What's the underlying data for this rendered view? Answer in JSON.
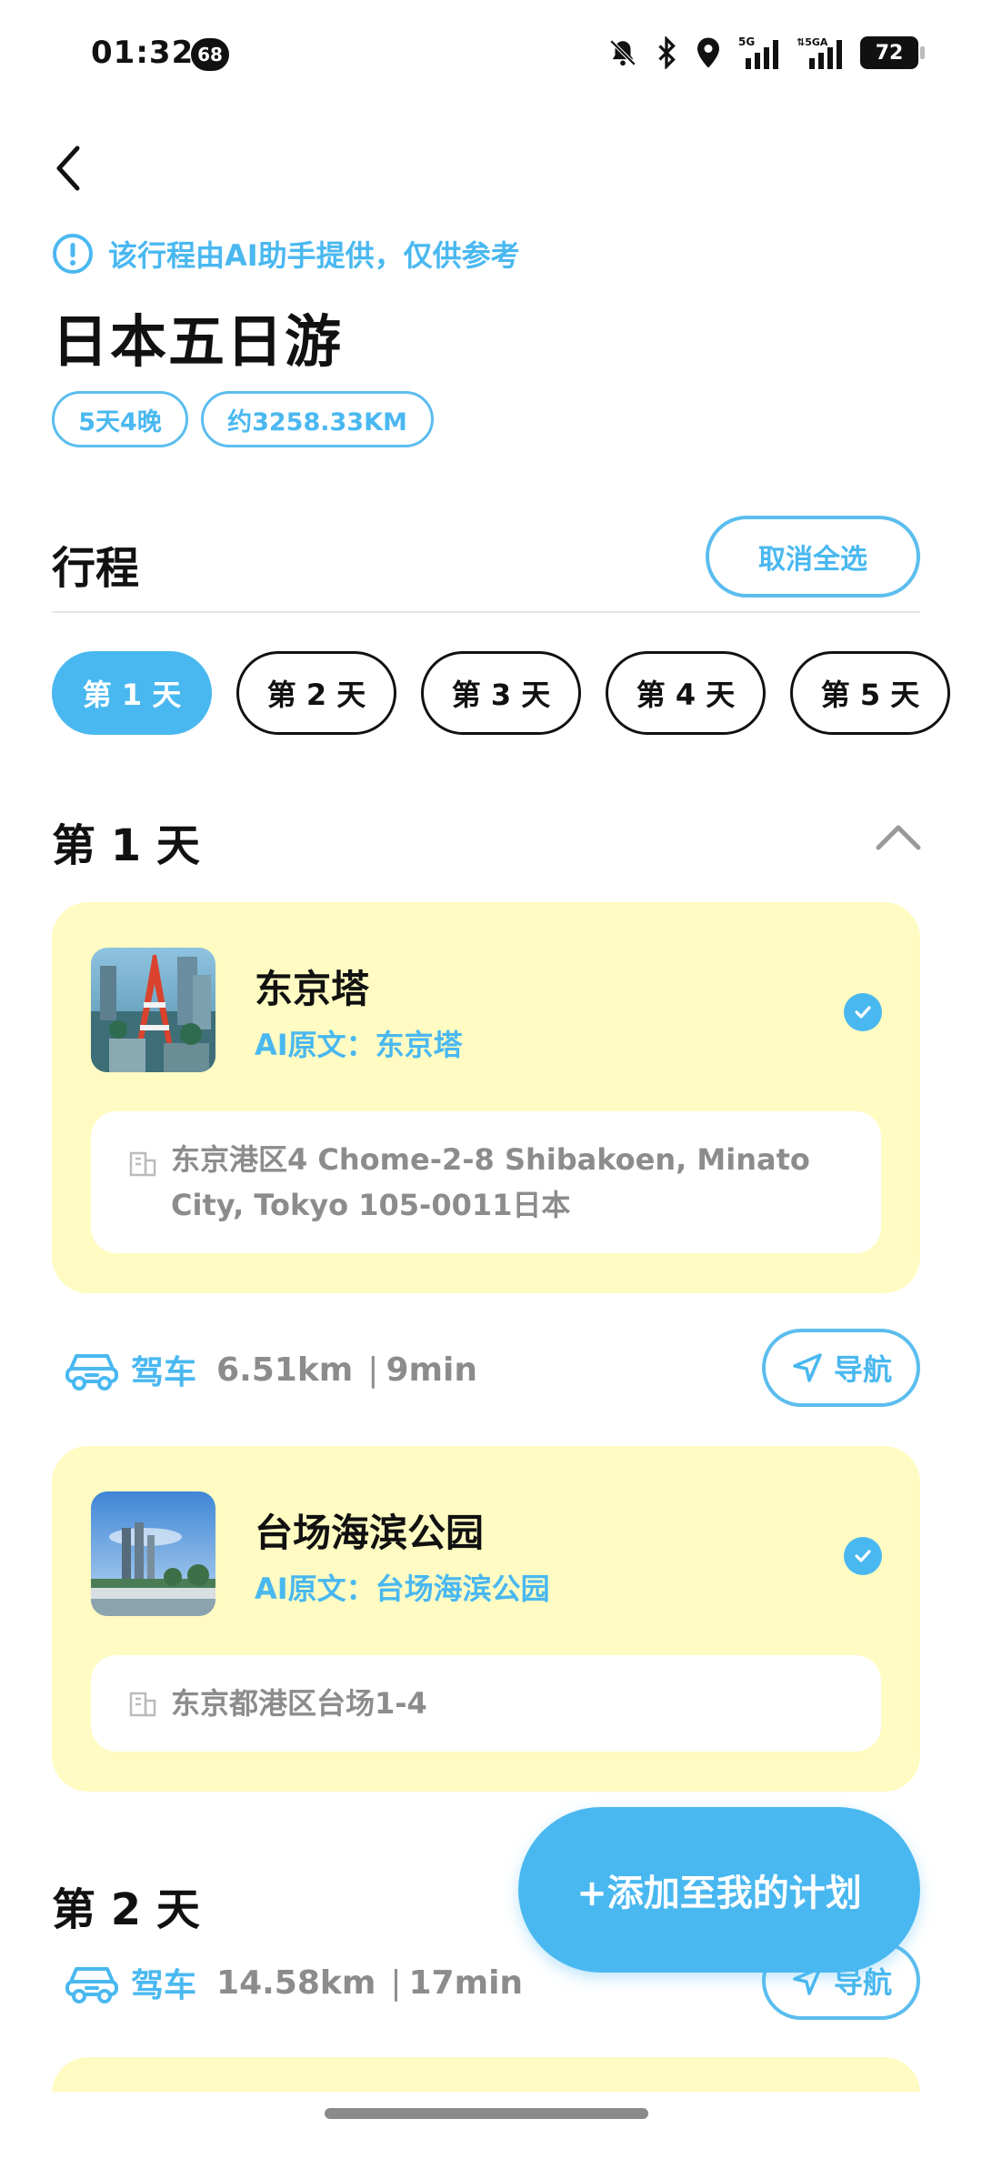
{
  "status_bar": {
    "time": "01:32",
    "badge": "68",
    "battery": "72"
  },
  "notice": {
    "text": "该行程由AI助手提供，仅供参考"
  },
  "trip": {
    "title": "日本五日游",
    "tags": [
      "5天4晚",
      "约3258.33KM"
    ]
  },
  "itinerary": {
    "section_title": "行程",
    "cancel_select_all": "取消全选",
    "day_tabs": [
      "第 1 天",
      "第 2 天",
      "第 3 天",
      "第 4 天",
      "第 5 天"
    ],
    "active_tab": 0
  },
  "days": [
    {
      "title": "第 1 天",
      "places": [
        {
          "name": "东京塔",
          "ai_text": "AI原文：东京塔",
          "address_line1": "东京港区4 Chome-2-8 Shibakoen, Minato",
          "address_line2": "City, Tokyo 105-0011日本",
          "checked": true
        },
        {
          "name": "台场海滨公园",
          "ai_text": "AI原文：台场海滨公园",
          "address_line1": "东京都港区台场1-4",
          "checked": true
        }
      ],
      "route": {
        "mode": "驾车",
        "distance": "6.51km",
        "sep": "|",
        "duration": "9min",
        "nav_label": "导航"
      }
    },
    {
      "title": "第 2 天",
      "route": {
        "mode": "驾车",
        "distance": "14.58km",
        "sep": "|",
        "duration": "17min",
        "nav_label": "导航"
      }
    }
  ],
  "fab": {
    "label": "+添加至我的计划"
  },
  "colors": {
    "accent": "#4ab8f0",
    "card_bg": "#fffbc2",
    "muted_text": "#8c8c8c"
  }
}
